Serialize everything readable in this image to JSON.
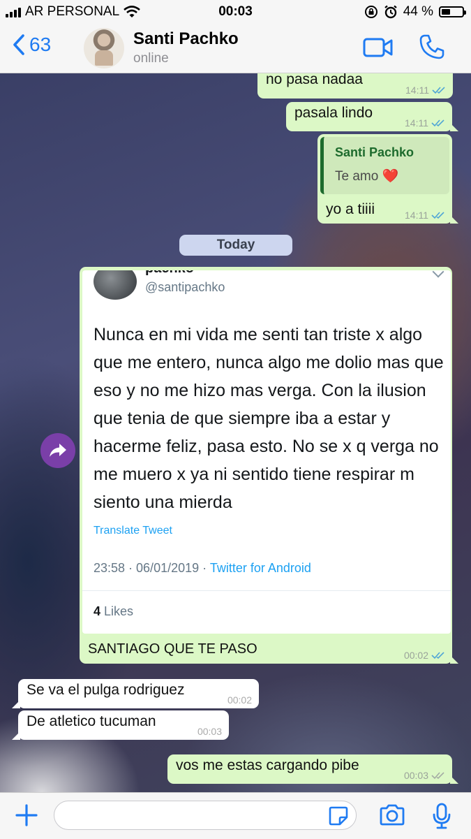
{
  "status_bar": {
    "carrier": "AR PERSONAL",
    "time": "00:03",
    "battery_percent": "44 %",
    "battery_level": 0.44
  },
  "header": {
    "back_count": "63",
    "contact_name": "Santi Pachko",
    "contact_status": "online",
    "accent_color": "#1f7bf2"
  },
  "messages": [
    {
      "direction": "out",
      "text": "no pasa nadaa",
      "time": "14:11",
      "read": true
    },
    {
      "direction": "out",
      "text": "pasala lindo",
      "time": "14:11",
      "read": true
    },
    {
      "direction": "out",
      "quote": {
        "author": "Santi Pachko",
        "text": "Te amo",
        "emoji": "❤️"
      },
      "text": "yo a tiiii",
      "time": "14:11",
      "read": true
    }
  ],
  "date_separator": "Today",
  "tweet": {
    "author_partial": "pachko",
    "handle": "@santipachko",
    "text": "Nunca en mi vida me senti tan triste x algo que me entero, nunca algo me dolio mas que eso y no me hizo mas verga. Con la ilusion que tenia de que siempre iba a estar y hacerme feliz, pasa esto. No se x q verga no me muero x ya ni sentido tiene respirar m siento una mierda",
    "translate": "Translate Tweet",
    "datetime": "23:58 · 06/01/2019 · ",
    "source": "Twitter for Android",
    "likes_count": "4",
    "likes_label": " Likes"
  },
  "messages_today": [
    {
      "direction": "out",
      "text": "SANTIAGO QUE TE PASO",
      "time": "00:02",
      "read": true
    },
    {
      "direction": "in",
      "text": "Se va el pulga rodriguez",
      "time": "00:02"
    },
    {
      "direction": "in",
      "text": "De atletico tucuman",
      "time": "00:03"
    },
    {
      "direction": "out",
      "text": "vos me estas cargando pibe",
      "time": "00:03",
      "read": false
    }
  ],
  "composer": {
    "placeholder": ""
  },
  "icons": [
    "back-chevron-icon",
    "video-call-icon",
    "phone-icon",
    "forward-icon",
    "plus-icon",
    "sticker-icon",
    "camera-icon",
    "microphone-icon",
    "double-check-icon",
    "wifi-icon",
    "lock-rotation-icon",
    "alarm-icon"
  ]
}
